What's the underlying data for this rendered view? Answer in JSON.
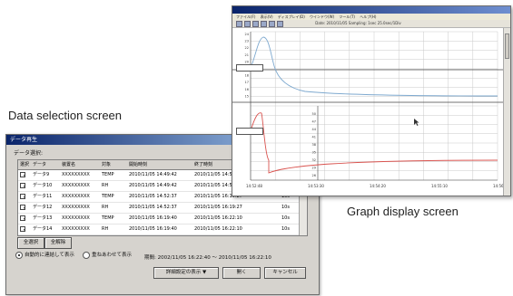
{
  "captions": {
    "data_selection": "Data selection screen",
    "graph_display": "Graph display screen"
  },
  "dialog": {
    "title": "データ再生",
    "subtitle": "データ選択:",
    "columns": [
      "選択",
      "データ",
      "装置名",
      "対象",
      "開始時刻",
      "終了時刻",
      ""
    ],
    "rows": [
      {
        "checked": true,
        "data": "データ9",
        "device": "XXXXXXXXX",
        "target": "TEMP",
        "start": "2010/11/05 14:49:42",
        "end": "2010/11/05 14:50",
        "interval": ""
      },
      {
        "checked": true,
        "data": "データ10",
        "device": "XXXXXXXXX",
        "target": "RH",
        "start": "2010/11/05 14:49:42",
        "end": "2010/11/05 14:50",
        "interval": ""
      },
      {
        "checked": true,
        "data": "データ11",
        "device": "XXXXXXXXX",
        "target": "TEMP",
        "start": "2010/11/05 14:52:37",
        "end": "2010/11/05 16:19:27",
        "interval": "10s"
      },
      {
        "checked": true,
        "data": "データ12",
        "device": "XXXXXXXXX",
        "target": "RH",
        "start": "2010/11/05 14:52:37",
        "end": "2010/11/05 16:19:27",
        "interval": "10s"
      },
      {
        "checked": true,
        "data": "データ13",
        "device": "XXXXXXXXX",
        "target": "TEMP",
        "start": "2010/11/05 16:19:40",
        "end": "2010/11/05 16:22:10",
        "interval": "10s"
      },
      {
        "checked": true,
        "data": "データ14",
        "device": "XXXXXXXXX",
        "target": "RH",
        "start": "2010/11/05 16:19:40",
        "end": "2010/11/05 16:22:10",
        "interval": "10s"
      }
    ],
    "select_all_label": "全選択",
    "deselect_all_label": "全解除",
    "radio_auto_label": "自動的に連結して表示",
    "radio_overlay_label": "重ねあわせて表示",
    "period_label": "期間:",
    "period_value": "2002/11/05 16:22:40 〜 2010/11/05 16:22:10",
    "detail_button_label": "詳細設定の表示 ▼",
    "open_button_label": "開く",
    "cancel_button_label": "キャンセル"
  },
  "graph": {
    "menu_items": [
      "ファイル(F)",
      "表示(V)",
      "ディスプレイ(D)",
      "ウインドウ(W)",
      "ツール(T)",
      "ヘルプ(H)"
    ],
    "toolbar_info": "Date: 2010/11/05   Sampling: 1sec   25.0sec/1Div",
    "x_ticks": [
      "14:52:48",
      "14:53:30",
      "14:54:20",
      "14:55:10",
      "14:56:00"
    ],
    "upper_y_ticks": [
      "24",
      "23",
      "22",
      "21",
      "20",
      "19",
      "18",
      "17",
      "16",
      "15"
    ],
    "lower_y_ticks": [
      "50",
      "47",
      "44",
      "41",
      "38",
      "35",
      "32",
      "29",
      "26"
    ],
    "colors": {
      "upper_trace": "#7ea9cf",
      "lower_trace": "#d9534f",
      "grid": "#c9c9c9",
      "axis": "#444444"
    }
  }
}
